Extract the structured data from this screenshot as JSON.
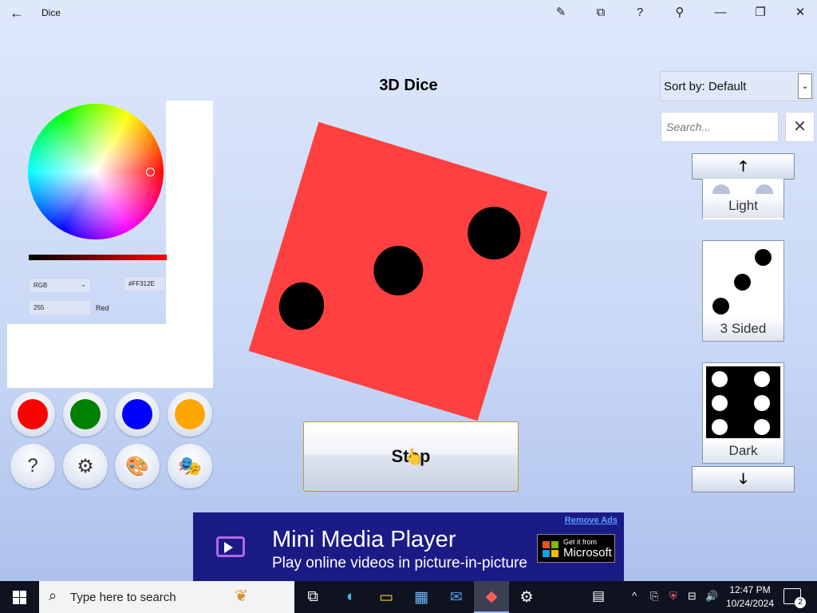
{
  "window": {
    "title": "Dice",
    "back_glyph": "←",
    "controls": {
      "pen": "✎",
      "view": "⧉",
      "help": "?",
      "pin": "⚲",
      "minimize": "—",
      "restore": "❐",
      "close": "✕"
    }
  },
  "main": {
    "title": "3D Dice",
    "stop_label": "Stop",
    "die": {
      "face_color": "#FE4040",
      "pip_color": "#000000",
      "pips_shown": 3
    }
  },
  "color_picker": {
    "mode_value": "RGB",
    "hex_value": "#FF312E",
    "channel_value": "255",
    "channel_label": "Red",
    "caret": "⌄"
  },
  "quick_colors": [
    {
      "name": "red",
      "hex": "#FF0000"
    },
    {
      "name": "green",
      "hex": "#008000"
    },
    {
      "name": "blue",
      "hex": "#0000FF"
    },
    {
      "name": "orange",
      "hex": "#FFA500"
    }
  ],
  "tool_buttons": {
    "help": "?",
    "settings": "⚙",
    "palette": "🎨",
    "theme": "🎭"
  },
  "side_panel": {
    "sort_value": "Sort by: Default",
    "sort_caret": "⌄",
    "search_placeholder": "Search...",
    "clear_glyph": "✕",
    "up_glyph": "🡑",
    "down_glyph": "🡓",
    "items": [
      {
        "label": "Light",
        "style": "light"
      },
      {
        "label": "3 Sided",
        "style": "three"
      },
      {
        "label": "Dark",
        "style": "dark"
      }
    ]
  },
  "ad": {
    "title": "Mini Media Player",
    "subtitle": "Play online videos in picture-in-picture",
    "remove_label": "Remove Ads",
    "badge_small": "Get it from",
    "badge_big": "Microsoft"
  },
  "taskbar": {
    "search_placeholder": "Type here to search",
    "search_glyph": "⌕",
    "leaf_glyph": "❦",
    "apps": [
      {
        "name": "task-view",
        "glyph": "⧉"
      },
      {
        "name": "edge",
        "glyph": "◐"
      },
      {
        "name": "file-explorer",
        "glyph": "▭"
      },
      {
        "name": "store",
        "glyph": "▦"
      },
      {
        "name": "mail",
        "glyph": "✉"
      },
      {
        "name": "dice-app",
        "glyph": "◆"
      },
      {
        "name": "settings",
        "glyph": "⚙"
      }
    ],
    "tray": {
      "news": "▤",
      "chevron": "^",
      "meet": "⎘",
      "defender": "⛨",
      "network": "⊟",
      "volume": "🔊"
    },
    "time": "12:47 PM",
    "date": "10/24/2024",
    "notification_count": "2"
  }
}
